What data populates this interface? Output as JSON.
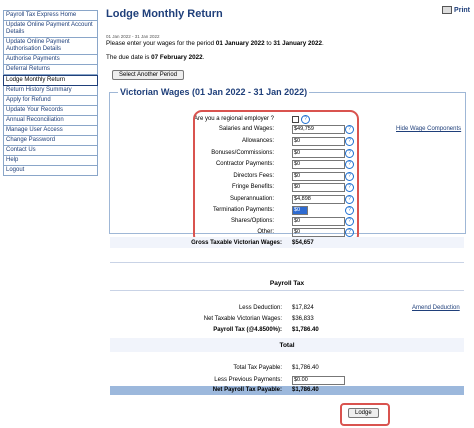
{
  "sidebar": {
    "items": [
      {
        "label": "Payroll Tax Express Home"
      },
      {
        "label": "Update Online Payment Account Details"
      },
      {
        "label": "Update Online Payment Authorisation Details"
      },
      {
        "label": "Authorise Payments"
      },
      {
        "label": "Deferral Returns"
      },
      {
        "label": "Lodge Monthly Return"
      },
      {
        "label": "Return History Summary"
      },
      {
        "label": "Apply for Refund"
      },
      {
        "label": "Update Your Records"
      },
      {
        "label": "Annual Reconciliation"
      },
      {
        "label": "Manage User Access"
      },
      {
        "label": "Change Password"
      },
      {
        "label": "Contact Us"
      },
      {
        "label": "Help"
      },
      {
        "label": "Logout"
      }
    ]
  },
  "header": {
    "title": "Lodge Monthly Return",
    "print_label": "Print",
    "date_range_small": "01 Jan 2022 - 31 Jan 2022",
    "intro_prefix": "Please enter your wages for the period ",
    "intro_from": "01 January 2022",
    "intro_to_word": " to ",
    "intro_to": "31 January 2022",
    "due_prefix": "The due date is ",
    "due_date": "07 February 2022",
    "select_period_button": "Select Another Period"
  },
  "wages": {
    "legend": "Victorian Wages  (01 Jan 2022 - 31 Jan 2022)",
    "regional_label": "Are you a regional employer ?",
    "hide_link": "Hide Wage Components",
    "fields": [
      {
        "label": "Salaries and Wages:",
        "value": "$49,759"
      },
      {
        "label": "Allowances:",
        "value": "$0"
      },
      {
        "label": "Bonuses/Commissions:",
        "value": "$0"
      },
      {
        "label": "Contractor Payments:",
        "value": "$0"
      },
      {
        "label": "Directors Fees:",
        "value": "$0"
      },
      {
        "label": "Fringe Benefits:",
        "value": "$0"
      },
      {
        "label": "Superannuation:",
        "value": "$4,898"
      },
      {
        "label": "Termination Payments:",
        "value": "$0"
      },
      {
        "label": "Shares/Options:",
        "value": "$0"
      },
      {
        "label": "Other:",
        "value": "$0"
      }
    ],
    "gross_label": "Gross Taxable Victorian Wages:",
    "gross_value": "$54,657"
  },
  "payroll_tax": {
    "title": "Payroll Tax",
    "less_deduction_label": "Less Deduction:",
    "less_deduction_value": "$17,824",
    "amend_link": "Amend Deduction",
    "net_label": "Net Taxable Victorian Wages:",
    "net_value": "$36,833",
    "tax_label": "Payroll Tax (@4.8500%):",
    "tax_value": "$1,786.40"
  },
  "total": {
    "title": "Total",
    "total_label": "Total Tax Payable:",
    "total_value": "$1,786.40",
    "less_prev_label": "Less Previous Payments:",
    "less_prev_value": "$0.00",
    "net_label": "Net Payroll Tax Payable:",
    "net_value": "$1,786.40"
  },
  "lodge_button": "Lodge",
  "help_glyph": "?"
}
